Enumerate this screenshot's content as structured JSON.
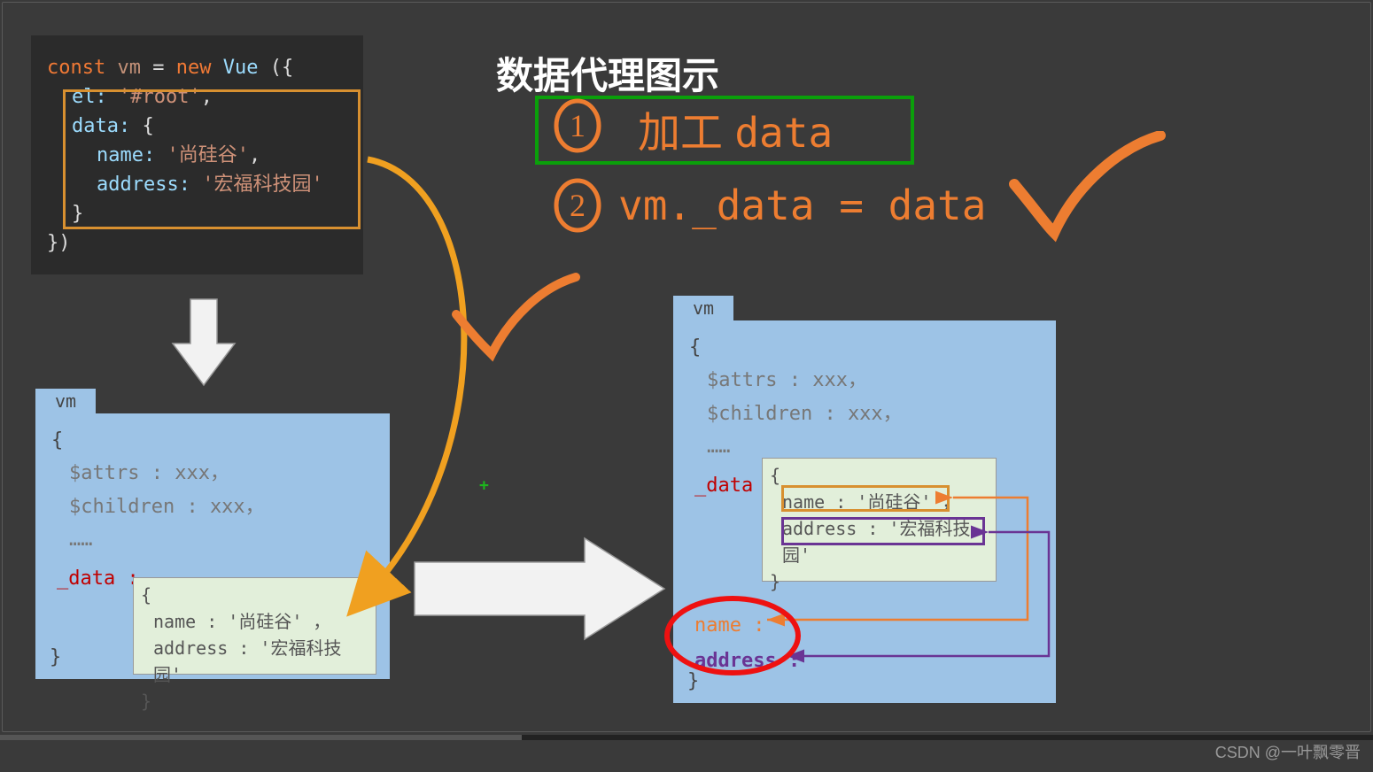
{
  "title": "数据代理图示",
  "code": {
    "line1": {
      "const": "const",
      "vm": "vm",
      "eq": " = ",
      "new": "new",
      "cls": "Vue",
      "op": "({"
    },
    "el_key": "el:",
    "el_val": "'#root'",
    "data_key": "data:",
    "data_open": "{",
    "name_key": "name:",
    "name_val": "'尚硅谷'",
    "addr_key": "address:",
    "addr_val": "'宏福科技园'",
    "close": "}",
    "end": "})"
  },
  "steps": {
    "s1": "加工 data",
    "s2": "vm._data = data"
  },
  "vmleft": {
    "label": "vm",
    "brace_open": "{",
    "attrs": "$attrs : xxx，",
    "children": "$children : xxx，",
    "dots": "……",
    "datakey": "_data :",
    "data": {
      "open": "{",
      "name": "name : '尚硅谷' ，",
      "addr": "address : '宏福科技园'",
      "close": "}"
    },
    "brace_close": "}"
  },
  "vmright": {
    "label": "vm",
    "brace_open": "{",
    "attrs": "$attrs : xxx，",
    "children": "$children : xxx，",
    "dots": "……",
    "datakey": "_data :",
    "data": {
      "open": "{",
      "name": "name : '尚硅谷' ，",
      "addr": "address : '宏福科技园'",
      "close": "}"
    },
    "proxy_name": "name :",
    "proxy_address": "address :",
    "brace_close": "}"
  },
  "watermark": "CSDN @一叶飘零晋",
  "plus_marker": "+"
}
